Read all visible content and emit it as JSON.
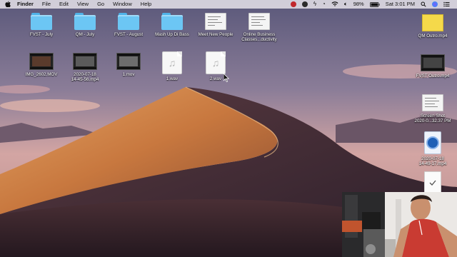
{
  "menubar": {
    "apple_icon": "apple-logo-icon",
    "app_name": "Finder",
    "menus": [
      "File",
      "Edit",
      "View",
      "Go",
      "Window",
      "Help"
    ],
    "status": {
      "icons": [
        "record-icon",
        "skype-icon",
        "bolt-icon",
        "time-machine-icon",
        "wifi-icon",
        "volume-icon"
      ],
      "battery": "98%",
      "battery_icon": "battery-icon",
      "clock": "Sat 3:01 PM",
      "extra_icons": [
        "search-icon",
        "siri-icon",
        "notification-center-icon"
      ]
    }
  },
  "desktop": {
    "row1": [
      {
        "label": "FVST - July",
        "kind": "folder"
      },
      {
        "label": "QM - July",
        "kind": "folder"
      },
      {
        "label": "FVST - August",
        "kind": "folder"
      },
      {
        "label": "Mash Up Di Bass",
        "kind": "folder"
      },
      {
        "label": "Meet New People",
        "kind": "document"
      },
      {
        "label": "Online Business\nClasses...ductivity",
        "kind": "document"
      }
    ],
    "row2": [
      {
        "label": "IMG_2602.MOV",
        "kind": "video"
      },
      {
        "label": "2020-07-18\n14-45-56.mp4",
        "kind": "video"
      },
      {
        "label": "1.mov",
        "kind": "video"
      },
      {
        "label": "1.wav",
        "kind": "audio"
      },
      {
        "label": "2.wav",
        "kind": "audio"
      }
    ],
    "right_column": [
      {
        "label": "QM Outro.mp4",
        "kind": "video"
      },
      {
        "label": "FVST Outro.mp4",
        "kind": "video"
      },
      {
        "label": "Screen Shot\n2020-0...32.37 PM",
        "kind": "screenshot"
      },
      {
        "label": "2020-07-18\n14-49-17.mp4",
        "kind": "quicktime"
      },
      {
        "label": "",
        "kind": "document"
      }
    ]
  },
  "colors": {
    "sky_top": "#5f5a7b",
    "sky_mid": "#c89aa2",
    "dune_light": "#d58a4c",
    "dune_shadow": "#3f2a36",
    "folder_blue": "#6cc6f4",
    "menubar": "#ebe8ee"
  }
}
